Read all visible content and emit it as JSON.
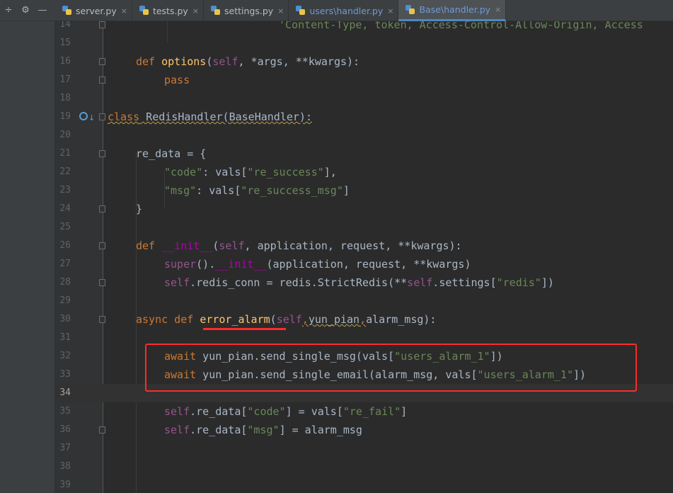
{
  "toolbar": {
    "tools": [
      "÷",
      "⚙",
      "—"
    ]
  },
  "tabs": [
    {
      "label": "server.py",
      "modified": false,
      "active": false
    },
    {
      "label": "tests.py",
      "modified": false,
      "active": false
    },
    {
      "label": "settings.py",
      "modified": false,
      "active": false
    },
    {
      "label": "users\\handler.py",
      "modified": true,
      "active": false
    },
    {
      "label": "Base\\handler.py",
      "modified": true,
      "active": true
    }
  ],
  "close_glyph": "×",
  "line_numbers": [
    "14",
    "15",
    "16",
    "17",
    "18",
    "19",
    "20",
    "21",
    "22",
    "23",
    "24",
    "25",
    "26",
    "27",
    "28",
    "29",
    "30",
    "31",
    "32",
    "33",
    "34",
    "35",
    "36",
    "37",
    "38",
    "39"
  ],
  "code": {
    "l14": "'Content-Type, token, Access-Control-Allow-Origin, Access",
    "l16_def": "def ",
    "l16_name": "options",
    "l16_open": "(",
    "l16_self": "self",
    "l16_rest": ", *args, **kwargs):",
    "l17": "pass",
    "l19_class": "class",
    "l19_rest": " RedisHandler(BaseHandler):",
    "l21": "re_data = {",
    "l22_key": "\"code\"",
    "l22_mid": ": vals[",
    "l22_val": "\"re_success\"",
    "l22_end": "],",
    "l23_key": "\"msg\"",
    "l23_mid": ": vals[",
    "l23_val": "\"re_success_msg\"",
    "l23_end": "]",
    "l24": "}",
    "l26_def": "def ",
    "l26_name": "__init__",
    "l26_open": "(",
    "l26_self": "self",
    "l26_rest": ", application, request, **kwargs):",
    "l27_super": "super",
    "l27_mid": "().",
    "l27_init": "__init__",
    "l27_rest": "(application, request, **kwargs)",
    "l28_self": "self",
    "l28_mid": ".redis_conn = redis.StrictRedis(**",
    "l28_self2": "self",
    "l28_mid2": ".settings[",
    "l28_str": "\"redis\"",
    "l28_end": "])",
    "l30_async": "async def ",
    "l30_name": "error_alarm",
    "l30_open": "(",
    "l30_self": "self",
    "l30_c1": ",",
    "l30_arg": "yun_pian",
    "l30_c2": ",",
    "l30_rest": "alarm_msg):",
    "l32_await": "await",
    "l32_mid": " yun_pian.send_single_msg(vals[",
    "l32_str": "\"users_alarm_1\"",
    "l32_end": "])",
    "l33_await": "await",
    "l33_mid": " yun_pian.send_single_email(alarm_msg, vals[",
    "l33_str": "\"users_alarm_1\"",
    "l33_end": "])",
    "l35_self": "self",
    "l35_mid": ".re_data[",
    "l35_key": "\"code\"",
    "l35_mid2": "] = vals[",
    "l35_val": "\"re_fail\"",
    "l35_end": "]",
    "l36_self": "self",
    "l36_mid": ".re_data[",
    "l36_key": "\"msg\"",
    "l36_end": "] = alarm_msg"
  },
  "colors": {
    "keyword": "#cc7832",
    "function": "#ffc66d",
    "string": "#6a8759",
    "self": "#94558d",
    "magic": "#b200b2",
    "highlight": "#ff2a2a"
  },
  "icons": {
    "implements_marker": "override-method-icon",
    "arrow": "↓"
  }
}
